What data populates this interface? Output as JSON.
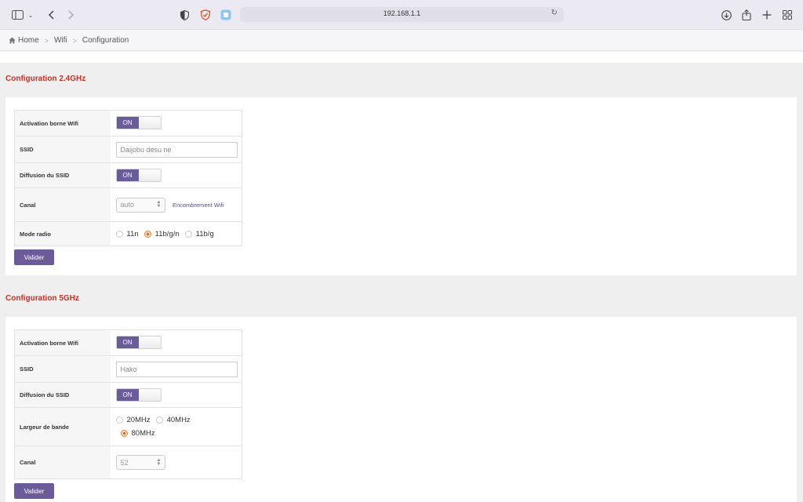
{
  "browser": {
    "url": "192.168.1.1"
  },
  "breadcrumb": [
    "Home",
    "Wifi",
    "Configuration"
  ],
  "sections": [
    {
      "title": "Configuration 2.4GHz",
      "activation_label": "Activation borne Wifi",
      "activation_state": "ON",
      "ssid_label": "SSID",
      "ssid_placeholder": "Daijobu desu ne",
      "broadcast_label": "Diffusion du SSID",
      "broadcast_state": "ON",
      "channel_label": "Canal",
      "channel_value": "auto",
      "channel_link": "Encombrement Wifi",
      "mode_label": "Mode radio",
      "mode_options": [
        "11n",
        "11b/g/n",
        "11b/g"
      ],
      "mode_selected": "11b/g/n",
      "submit_label": "Valider"
    },
    {
      "title": "Configuration 5GHz",
      "activation_label": "Activation borne Wifi",
      "activation_state": "ON",
      "ssid_label": "SSID",
      "ssid_placeholder": "Hako",
      "broadcast_label": "Diffusion du SSID",
      "broadcast_state": "ON",
      "bandwidth_label": "Largeur de bande",
      "bandwidth_options": [
        "20MHz",
        "40MHz",
        "80MHz"
      ],
      "bandwidth_selected": "80MHz",
      "channel_label": "Canal",
      "channel_value": "52",
      "submit_label": "Valider"
    }
  ],
  "colors": {
    "accent": "#6b5b98",
    "section_title": "#c33326",
    "radio_selected": "#e0893a"
  }
}
